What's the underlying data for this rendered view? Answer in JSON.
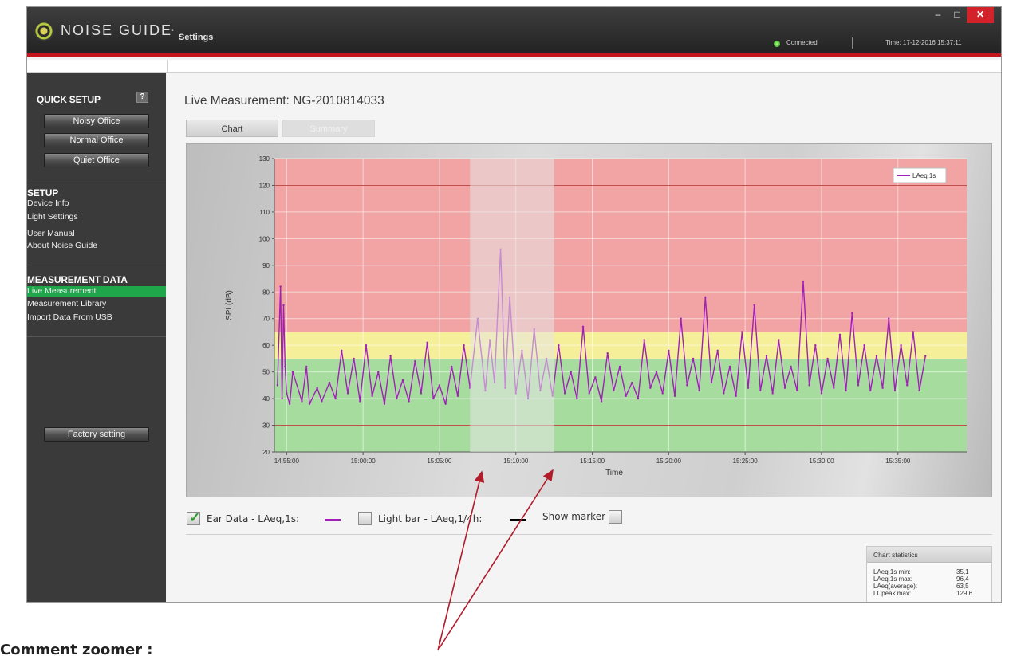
{
  "window": {
    "app_name": "NOISE GUIDE",
    "title_separator": "·",
    "subtitle": "Settings",
    "status": "Connected",
    "time": "Time: 17-12-2016 15:37:11",
    "controls": {
      "minimize": "–",
      "maximize": "□",
      "close": "✕"
    }
  },
  "sidebar": {
    "quick_setup": {
      "heading": "QUICK SETUP",
      "help_label": "?",
      "buttons": [
        "Noisy Office",
        "Normal Office",
        "Quiet Office"
      ]
    },
    "setup": {
      "heading": "SETUP",
      "items": [
        "Device Info",
        "Light Settings",
        "User Manual",
        "About Noise Guide"
      ]
    },
    "measurement_data": {
      "heading": "MEASUREMENT DATA",
      "items": [
        "Live Measurement",
        "Measurement Library",
        "Import Data From USB"
      ],
      "active_index": 0
    },
    "factory_button": "Factory setting"
  },
  "main": {
    "title": "Live Measurement: NG-2010814033",
    "tabs": [
      {
        "label": "Chart",
        "active": true
      },
      {
        "label": "Summary",
        "active": false
      }
    ]
  },
  "chart_data": {
    "type": "line",
    "ylabel": "SPL(dB)",
    "xlabel": "Time",
    "ylim": [
      20,
      130
    ],
    "yticks": [
      20,
      30,
      40,
      50,
      60,
      70,
      80,
      90,
      100,
      110,
      120,
      130
    ],
    "xticks": [
      "14:55:00",
      "15:00:00",
      "15:05:00",
      "15:10:00",
      "15:15:00",
      "15:20:00",
      "15:25:00",
      "15:30:00",
      "15:35:00"
    ],
    "xrange_minutes": [
      -0.8,
      44.5
    ],
    "x_start": "14:55:00",
    "zones": [
      {
        "from": 20,
        "to": 55,
        "color": "#a6dd9e"
      },
      {
        "from": 55,
        "to": 65,
        "color": "#f6ef9a"
      },
      {
        "from": 65,
        "to": 130,
        "color": "#f2a3a3"
      }
    ],
    "threshold_lines": [
      30,
      120
    ],
    "highlight_minutes": [
      12.0,
      17.5
    ],
    "legend_entry": "LAeq,1s",
    "series_color": "#a020b8",
    "series": [
      {
        "name": "LAeq,1s",
        "x_minutes": [
          -0.6,
          -0.4,
          -0.3,
          -0.2,
          -0.1,
          0.0,
          0.2,
          0.4,
          1.0,
          1.3,
          1.5,
          2.0,
          2.3,
          2.8,
          3.2,
          3.6,
          4.0,
          4.4,
          4.8,
          5.2,
          5.6,
          6.0,
          6.4,
          6.8,
          7.2,
          7.6,
          8.0,
          8.4,
          8.8,
          9.2,
          9.6,
          10.0,
          10.4,
          10.8,
          11.2,
          11.6,
          12.0,
          12.5,
          13.0,
          13.3,
          13.6,
          14.0,
          14.3,
          14.6,
          15.0,
          15.4,
          15.8,
          16.2,
          16.6,
          17.0,
          17.4,
          17.8,
          18.2,
          18.6,
          19.0,
          19.4,
          19.8,
          20.2,
          20.6,
          21.0,
          21.4,
          21.8,
          22.2,
          22.6,
          23.0,
          23.4,
          23.8,
          24.2,
          24.6,
          25.0,
          25.4,
          25.8,
          26.2,
          26.6,
          27.0,
          27.4,
          27.8,
          28.2,
          28.6,
          29.0,
          29.4,
          29.8,
          30.2,
          30.6,
          31.0,
          31.4,
          31.8,
          32.2,
          32.6,
          33.0,
          33.4,
          33.8,
          34.2,
          34.6,
          35.0,
          35.4,
          35.8,
          36.2,
          36.6,
          37.0,
          37.4,
          37.8,
          38.2,
          38.6,
          39.0,
          39.4,
          39.8,
          40.2,
          40.6,
          41.0,
          41.4,
          41.8
        ],
        "values": [
          45,
          82,
          40,
          75,
          52,
          42,
          38,
          50,
          39,
          52,
          38,
          44,
          39,
          46,
          40,
          58,
          42,
          55,
          39,
          60,
          41,
          50,
          38,
          56,
          40,
          47,
          39,
          54,
          42,
          61,
          40,
          45,
          38,
          52,
          41,
          60,
          44,
          70,
          43,
          62,
          46,
          96,
          44,
          78,
          42,
          58,
          40,
          66,
          43,
          55,
          41,
          60,
          42,
          50,
          40,
          67,
          42,
          48,
          39,
          57,
          43,
          52,
          41,
          46,
          40,
          62,
          44,
          50,
          42,
          58,
          41,
          70,
          45,
          55,
          43,
          78,
          46,
          58,
          42,
          52,
          41,
          65,
          44,
          75,
          43,
          56,
          42,
          62,
          44,
          52,
          43,
          84,
          45,
          60,
          42,
          55,
          44,
          64,
          43,
          72,
          45,
          60,
          43,
          56,
          44,
          70,
          43,
          60,
          45,
          65,
          43,
          56
        ]
      }
    ]
  },
  "legend_row": {
    "ear_data": "Ear Data - LAeq,1s:",
    "light_bar": "Light bar - LAeq,1/4h:",
    "show_marker": "Show marker",
    "check_mark": "✓",
    "ear_color": "#a020b8",
    "light_color": "#000000"
  },
  "stats": {
    "heading": "Chart statistics",
    "rows": [
      {
        "label": "LAeq,1s min:",
        "value": "35,1"
      },
      {
        "label": "LAeq,1s max:",
        "value": "96,4"
      },
      {
        "label": "LAeq(average):",
        "value": "63,5"
      },
      {
        "label": "LCpeak max:",
        "value": "129,6"
      }
    ]
  },
  "annotation": {
    "caption": "Comment zoomer :",
    "arrow_color": "#b01c2a"
  }
}
